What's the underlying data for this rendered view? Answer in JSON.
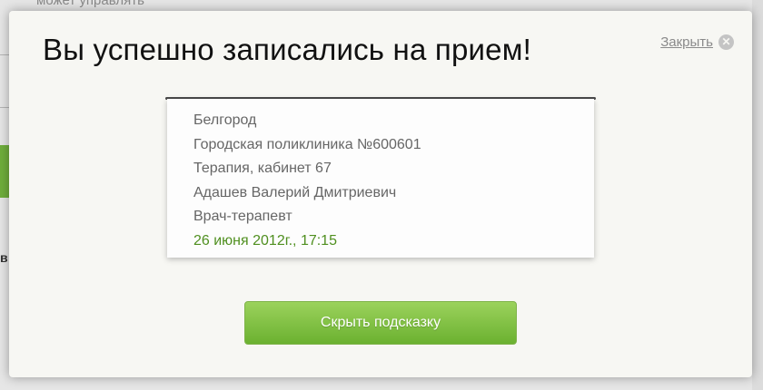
{
  "background": {
    "partial_text": "может управлять",
    "partial_glyph": "в"
  },
  "modal": {
    "title": "Вы успешно записались на прием!",
    "close_label": "Закрыть",
    "appointment": {
      "city": "Белгород",
      "clinic": "Городская поликлиника №600601",
      "department": "Терапия, кабинет 67",
      "doctor_name": "Адашев Валерий Дмитриевич",
      "doctor_role": "Врач-терапевт",
      "datetime": "26 июня 2012г., 17:15"
    },
    "hide_button_label": "Скрыть подсказку"
  },
  "colors": {
    "accent_green": "#6bb130",
    "date_green": "#4f8f1f"
  }
}
